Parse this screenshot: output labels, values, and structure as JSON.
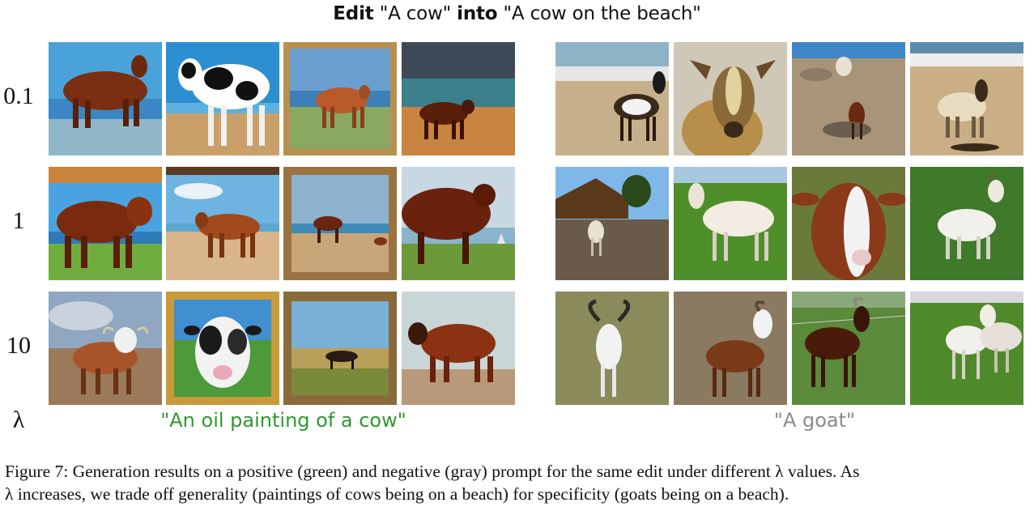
{
  "figure": {
    "title_parts": [
      "Edit",
      "\"A cow\"",
      "into",
      "\"A cow on the beach\""
    ],
    "lambda_values": [
      "0.1",
      "1",
      "10"
    ],
    "lambda_symbol": "λ",
    "positive_prompt": "\"An oil painting of a cow\"",
    "negative_prompt": "\"A goat\"",
    "positive_color": "#2e9a2e",
    "negative_color": "#8a8a8a",
    "caption_line1": "Figure 7: Generation results on a positive (green) and negative (gray) prompt for the same edit under different λ values. As",
    "caption_line2": "λ increases, we trade off generality (paintings of cows being on a beach) for specificity (goats being on a beach)."
  },
  "images": {
    "cow_row_01": [
      "cow painting on beach",
      "holstein cow painting",
      "framed cow painting",
      "cow walking on beach"
    ],
    "cow_row_1": [
      "brown cow painting",
      "cow on beach painting",
      "framed cow on beach",
      "dark cow painting"
    ],
    "cow_row_10": [
      "cow with horns painting",
      "framed cow portrait",
      "framed cow in field",
      "brown cow painting"
    ],
    "goat_row_01": [
      "goat on beach",
      "goat close-up",
      "goat on rocky shore",
      "goat on beach"
    ],
    "goat_row_1": [
      "goat near hut",
      "white goat in field",
      "goat portrait",
      "white goat on grass"
    ],
    "goat_row_10": [
      "horned goat",
      "brown goat",
      "dark goat",
      "white goats"
    ]
  }
}
